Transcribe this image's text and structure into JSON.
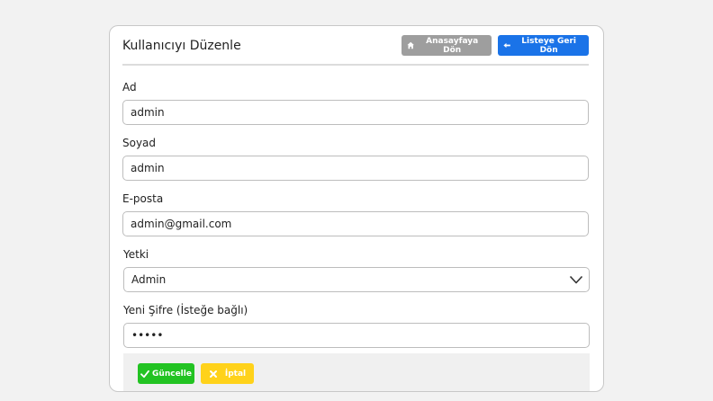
{
  "page": {
    "title": "Kullanıcıyı Düzenle"
  },
  "header": {
    "home_button": "Anasayfaya Dön",
    "back_button": "Listeye Geri Dön",
    "home_icon": "home-icon",
    "back_icon": "arrow-left-icon"
  },
  "form": {
    "first_name": {
      "label": "Ad",
      "value": "admin"
    },
    "last_name": {
      "label": "Soyad",
      "value": "admin"
    },
    "email": {
      "label": "E-posta",
      "value": "admin@gmail.com"
    },
    "role": {
      "label": "Yetki",
      "value": "Admin"
    },
    "password": {
      "label": "Yeni Şifre (İsteğe bağlı)",
      "value": "admin"
    }
  },
  "actions": {
    "update_button": "Güncelle",
    "cancel_button": "İptal",
    "update_icon": "check-icon",
    "cancel_icon": "x-icon"
  },
  "colors": {
    "home_button": "#9e9e9e",
    "back_button": "#1a73e8",
    "update_button": "#22c322",
    "cancel_button": "#ffd21a"
  }
}
